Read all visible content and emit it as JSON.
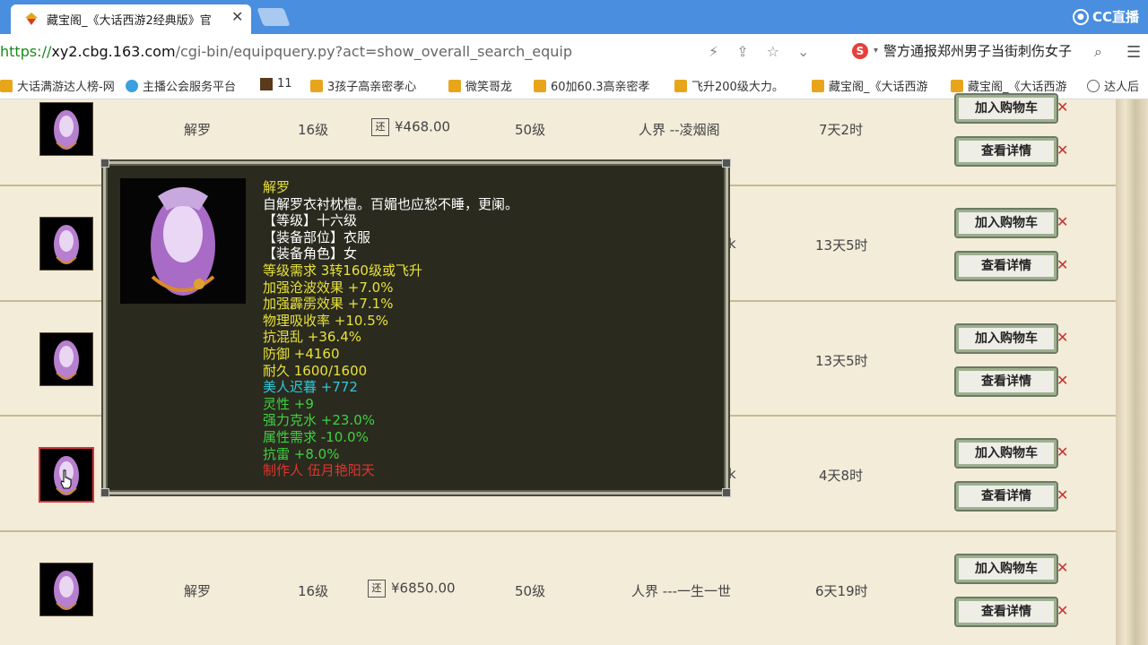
{
  "browser": {
    "tab_title": "藏宝阁_《大话西游2经典版》官",
    "tab_close": "✕",
    "brand_name": "CC直播",
    "url_proto": "https://",
    "url_host": "xy2.cbg.163.com",
    "url_path": "/cgi-bin/equipquery.py?act=show_overall_search_equip",
    "news_text": "警方通报郑州男子当街刺伤女子",
    "bookmarks": [
      "大话满游达人榜-网",
      "主播公会服务平台",
      "11",
      "3孩子高亲密孝心",
      "微笑哥龙",
      "60加60.3高亲密孝",
      "飞升200级大力。",
      "藏宝阁_《大话西游",
      "藏宝阁_《大话西游",
      "达人后"
    ]
  },
  "listing": {
    "rows": [
      {
        "name": "解罗",
        "level": "16级",
        "price": "¥468.00",
        "req_level": "50级",
        "server": "人界 --凌烟阁",
        "time_left": "7天2时"
      },
      {
        "name": "",
        "level": "",
        "price": "",
        "req_level": "",
        "server": "",
        "time_left": "13天5时"
      },
      {
        "name": "",
        "level": "",
        "price": "",
        "req_level": "",
        "server": "",
        "time_left": "13天5时"
      },
      {
        "name": "",
        "level": "",
        "price": "",
        "req_level": "",
        "server": "",
        "time_left": "4天8时"
      },
      {
        "name": "解罗",
        "level": "16级",
        "price": "¥6850.00",
        "req_level": "50级",
        "server": "人界 ---一生一世",
        "time_left": "6天19时"
      }
    ],
    "price_icon_text": "还",
    "add_cart_label": "加入购物车",
    "details_label": "查看详情",
    "remove_mark": "✕"
  },
  "tooltip": {
    "lines": [
      {
        "text": "解罗",
        "color": "#e8e23a"
      },
      {
        "text": "自解罗衣衬枕檀。百媚也应愁不睡，更阑。",
        "color": "#ffffff"
      },
      {
        "text": "【等级】十六级",
        "color": "#ffffff"
      },
      {
        "text": "【装备部位】衣服",
        "color": "#ffffff"
      },
      {
        "text": "【装备角色】女",
        "color": "#ffffff"
      },
      {
        "text": "等级需求 3转160级或飞升",
        "color": "#e8e23a"
      },
      {
        "text": "加强沧波效果 +7.0%",
        "color": "#e8e23a"
      },
      {
        "text": "加强霹雳效果 +7.1%",
        "color": "#e8e23a"
      },
      {
        "text": "物理吸收率 +10.5%",
        "color": "#e8e23a"
      },
      {
        "text": "抗混乱 +36.4%",
        "color": "#e8e23a"
      },
      {
        "text": "防御 +4160",
        "color": "#e8e23a"
      },
      {
        "text": "耐久 1600/1600",
        "color": "#e8e23a"
      },
      {
        "text": "美人迟暮 +772",
        "color": "#31c8d8"
      },
      {
        "text": "灵性 +9",
        "color": "#3fd23f"
      },
      {
        "text": "强力克水 +23.0%",
        "color": "#3fd23f"
      },
      {
        "text": "属性需求 -10.0%",
        "color": "#3fd23f"
      },
      {
        "text": "抗雷 +8.0%",
        "color": "#3fd23f"
      },
      {
        "text": "制作人 伍月艳阳天",
        "color": "#e0352c"
      }
    ]
  }
}
